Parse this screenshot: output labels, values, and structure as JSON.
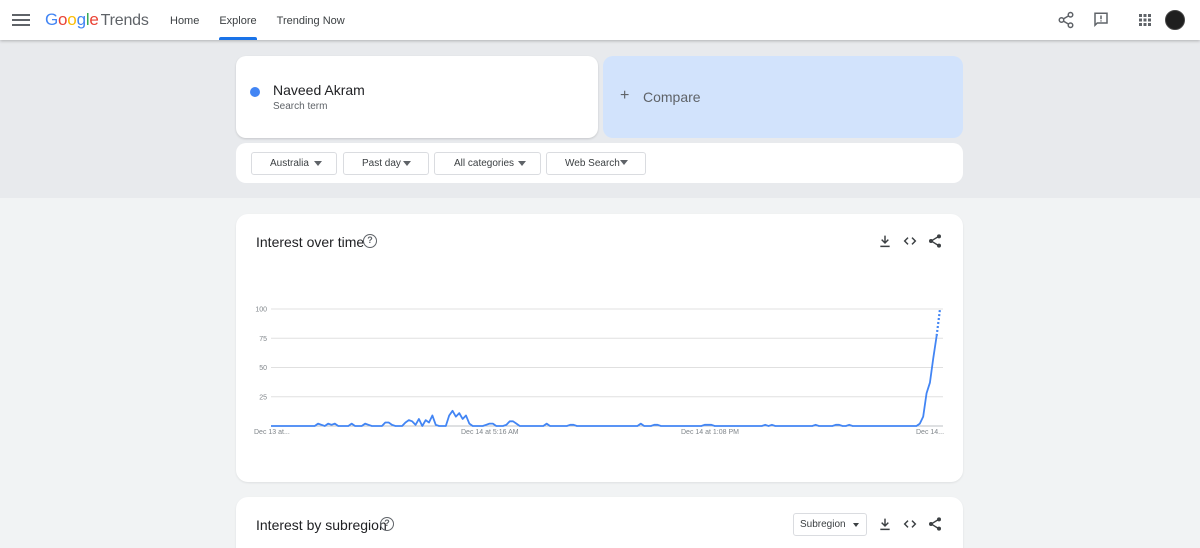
{
  "header": {
    "logo_google": [
      "G",
      "o",
      "o",
      "g",
      "l",
      "e"
    ],
    "logo_trends": "Trends",
    "nav": [
      {
        "label": "Home",
        "active": false
      },
      {
        "label": "Explore",
        "active": true
      },
      {
        "label": "Trending Now",
        "active": false
      }
    ],
    "icons": [
      "menu-icon",
      "share-icon",
      "feedback-icon",
      "apps-icon",
      "avatar"
    ]
  },
  "search": {
    "term_name": "Naveed Akram",
    "term_type": "Search term",
    "term_color": "#4285f4",
    "compare_label": "Compare"
  },
  "filters": [
    {
      "label": "Australia"
    },
    {
      "label": "Past day"
    },
    {
      "label": "All categories"
    },
    {
      "label": "Web Search"
    }
  ],
  "interest_over_time": {
    "title": "Interest over time",
    "help": "?",
    "actions": [
      "download-icon",
      "embed-icon",
      "share-icon"
    ]
  },
  "chart_data": {
    "type": "line",
    "x_tick_labels": [
      "Dec 13 at...",
      "Dec 14 at 5:16 AM",
      "Dec 14 at 1:08 PM",
      "Dec 14..."
    ],
    "y_ticks": [
      100,
      75,
      50,
      25
    ],
    "ylim": [
      0,
      100
    ],
    "grid": true,
    "series": [
      {
        "color": "#4285f4",
        "values": [
          0,
          0,
          0,
          0,
          0,
          0,
          0,
          0,
          0,
          0,
          0,
          0,
          0,
          0,
          2,
          1,
          0,
          2,
          1,
          2,
          0,
          0,
          0,
          0,
          2,
          0,
          0,
          0,
          2,
          1,
          0,
          0,
          0,
          0,
          3,
          3,
          1,
          0,
          0,
          0,
          3,
          5,
          4,
          1,
          6,
          0,
          5,
          3,
          9,
          1,
          0,
          0,
          0,
          9,
          13,
          8,
          11,
          6,
          9,
          2,
          0,
          0,
          0,
          0,
          1,
          2,
          2,
          0,
          0,
          0,
          1,
          4,
          4,
          2,
          0,
          0,
          0,
          0,
          0,
          0,
          0,
          0,
          2,
          0,
          0,
          0,
          0,
          0,
          0,
          1,
          1,
          0,
          0,
          0,
          0,
          0,
          0,
          0,
          0,
          0,
          0,
          0,
          0,
          0,
          0,
          0,
          0,
          0,
          0,
          0,
          2,
          0,
          0,
          0,
          1,
          1,
          0,
          0,
          0,
          0,
          0,
          0,
          0,
          0,
          0,
          0,
          0,
          0,
          0,
          1,
          1,
          1,
          0,
          0,
          0,
          0,
          0,
          0,
          0,
          0,
          0,
          0,
          0,
          0,
          0,
          0,
          0,
          1,
          0,
          1,
          0,
          0,
          0,
          0,
          0,
          0,
          0,
          0,
          0,
          0,
          0,
          0,
          1,
          0,
          0,
          0,
          0,
          0,
          1,
          1,
          0,
          0,
          1,
          0,
          0,
          0,
          0,
          0,
          0,
          0,
          0,
          0,
          0,
          0,
          0,
          0,
          0,
          0,
          0,
          0,
          0,
          0,
          0,
          2,
          8,
          28,
          37,
          58,
          77
        ],
        "partial_values": [
          77,
          100
        ]
      }
    ]
  },
  "interest_by_subregion": {
    "title": "Interest by subregion",
    "help": "?",
    "select_label": "Subregion",
    "actions": [
      "download-icon",
      "embed-icon",
      "share-icon"
    ]
  }
}
